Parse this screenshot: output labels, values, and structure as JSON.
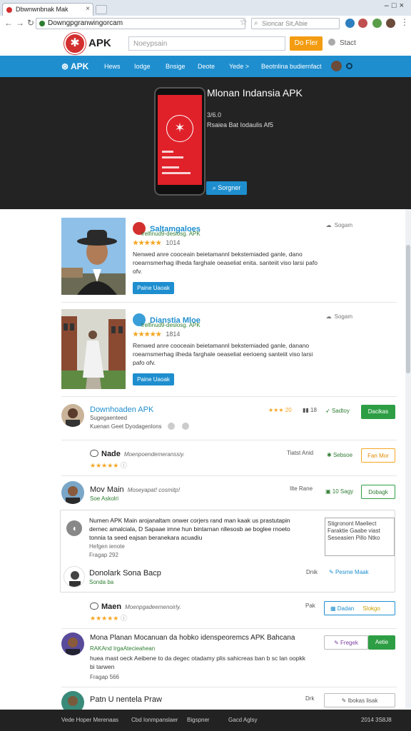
{
  "browser": {
    "tab_title": "Dbwnwnbnak Mak",
    "url": "Downgpgranwingorcam",
    "search_placeholder": "Sioncar Sit,Abie"
  },
  "site": {
    "logo_text": "APK",
    "search_placeholder": "Noeypsain",
    "search_button": "Do Fler",
    "start_link": "Stact"
  },
  "nav": {
    "brand": "APK",
    "items": [
      "Hews",
      "Iodge",
      "Bnsige",
      "Deote",
      "Yede >",
      "Beotnlina budiernfact"
    ]
  },
  "hero": {
    "title": "Mlonan Indansia APK",
    "version": "3/6.0",
    "meta": "Rsaiea Bat  Iodaulis Af5",
    "button": "Sorgner"
  },
  "featured": [
    {
      "title": "Saltamgaloes",
      "sub": "lrelfinud9-deslosg. APK",
      "rating": "★★★★★",
      "count": "1014",
      "desc": "Nenwed anre cooceain beietamannl bekstemiaded ganle, dano roearnsmerhag ilheda farghale oeaseliat enita. santeiit viso larsi pafo ofv.",
      "button": "Paine Uaoak",
      "share": "Sogam"
    },
    {
      "title": "Dianstia Mloe",
      "sub": "lrelfinud9-deslosg. APK",
      "rating": "★★★★★",
      "count": "1814",
      "desc": "Renwed anre cooceain beietamannl bekstemiaded ganle, danano roearnsmerhag ilheda farghale oeaseliat eerioeng santeiit viso larsi pafo ofv.",
      "button": "Paine Uaoak",
      "share": "Sogam"
    }
  ],
  "list": [
    {
      "name": "Downhoaden APK",
      "sub1": "Sugegaenteed",
      "sub2": "Kuenan Geet Dyodagenlons",
      "rating_text": "★★★ 20",
      "stats": "18",
      "action": "Sadtoy",
      "button": "Dacikas"
    },
    {
      "name": "Nade",
      "note": "Moenpoendemeranssiy.",
      "rating": "★★★★★",
      "right": "Tiatst Anid",
      "action": "Sebsoe",
      "button": "Fan Mor"
    },
    {
      "name": "Mov Main",
      "note": "Moseyapat! cosmitp!",
      "sub": "Soe Askolri",
      "right": "Ilte Rane",
      "action": "10 Sagy",
      "button": "Dobagk"
    }
  ],
  "comment": {
    "body": "Numen APK Main arojanaltam onwer corjers rand man kaak us prastutapin dernec amalciala, D Sapaae imne hun bintarnan nllesosb ae boglee rnoeto tonnia ta seed eajsan beranekara acuadiu",
    "reply_note": "Hefgen ienote",
    "meta": "Fragap 292",
    "textarea": "Stigronont Maeliect Faraktie Gaabe viast Seseasien Pillo Ntko",
    "name": "Donolark Sona Bacp",
    "sub": "Sonda ba",
    "right": "Dnik",
    "action": "Pesme Maak"
  },
  "list2": [
    {
      "name": "Maen",
      "note": "Moenpgadeemenoirly.",
      "rating": "★★★★★",
      "right": "Pak",
      "button_left": "Dadan",
      "button_right": "Slokgo"
    },
    {
      "name": "Mona Planan Mocanuan da hobko idenspeoremcs APK Bahcana",
      "sub": "RAKAnd IrgaAtecieahean",
      "desc": "huea mast oeck Aeibene to da degec otadamy plis sahicreas ban b sc lan oopkk bi tarwen",
      "meta": "Fragap 566",
      "button_left": "Fregek",
      "button_right": "Aetie"
    },
    {
      "name": "Patn U nentela Praw",
      "right": "Drk",
      "button": "Ibokas lisak"
    }
  ],
  "footer": {
    "items": [
      "Vede Hoper Merenaas",
      "Cbd Ionmpanslaer",
      "Bigspner",
      "Gacd Aglsy"
    ],
    "right": "2014 3S8J8"
  }
}
